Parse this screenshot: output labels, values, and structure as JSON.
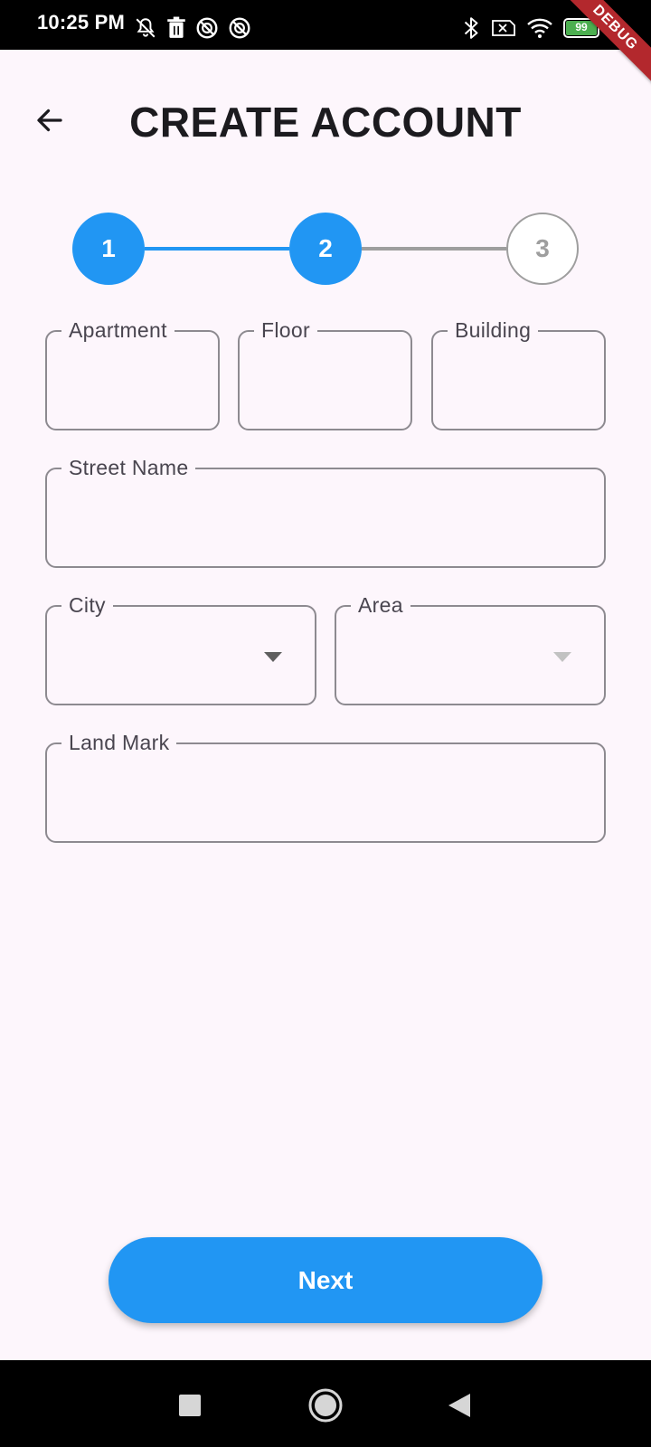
{
  "status_bar": {
    "time": "10:25 PM",
    "battery_level": "99",
    "left_icons": [
      "muted-bell-icon",
      "trash-icon",
      "do-not-disturb-icon",
      "do-not-disturb-icon"
    ],
    "right_icons": [
      "bluetooth-icon",
      "no-sim-icon",
      "wifi-icon",
      "battery-icon",
      "charging-icon"
    ]
  },
  "debug_banner": "DEBUG",
  "header": {
    "title": "CREATE ACCOUNT",
    "back_icon": "arrow-left-icon"
  },
  "stepper": {
    "current_step": 2,
    "steps": [
      {
        "label": "1",
        "state": "completed"
      },
      {
        "label": "2",
        "state": "active"
      },
      {
        "label": "3",
        "state": "inactive"
      }
    ]
  },
  "form": {
    "apartment": {
      "label": "Apartment",
      "value": ""
    },
    "floor": {
      "label": "Floor",
      "value": ""
    },
    "building": {
      "label": "Building",
      "value": ""
    },
    "street_name": {
      "label": "Street Name",
      "value": ""
    },
    "city": {
      "label": "City",
      "value": "",
      "enabled": true
    },
    "area": {
      "label": "Area",
      "value": "",
      "enabled": false
    },
    "land_mark": {
      "label": "Land Mark",
      "value": ""
    }
  },
  "actions": {
    "next_label": "Next"
  },
  "nav_bar": {
    "icons": [
      "recents-square-icon",
      "home-circle-icon",
      "back-triangle-icon"
    ]
  },
  "colors": {
    "primary": "#2196f3",
    "background": "#fdf6fc",
    "title_text": "#1c1b1f",
    "outline": "#8d8a90",
    "label_text": "#49454f",
    "inactive": "#9e9e9e",
    "debug_banner": "#b3282d",
    "system_bars": "#000000"
  }
}
